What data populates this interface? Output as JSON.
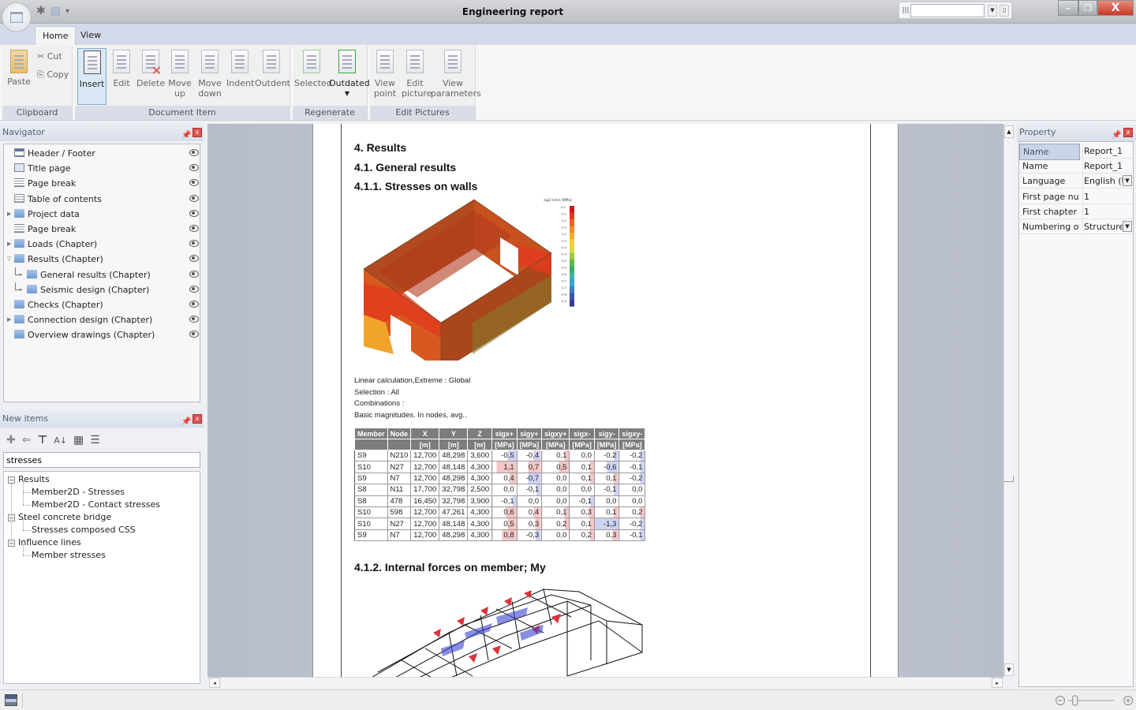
{
  "window": {
    "title": "Engineering report",
    "controls": {
      "minimize": "–",
      "maximize": "❐",
      "close": "X"
    }
  },
  "quick_access": {
    "gear": "✱",
    "doc": "▤",
    "more": "▾"
  },
  "ribbon": {
    "tabs": [
      {
        "label": "Home",
        "active": true
      },
      {
        "label": "View",
        "active": false
      }
    ],
    "groups": {
      "clipboard": {
        "label": "Clipboard",
        "paste": "Paste",
        "cut": "Cut",
        "copy": "Copy"
      },
      "document_item": {
        "label": "Document Item",
        "buttons": [
          "Insert",
          "Edit",
          "Delete",
          "Move up",
          "Move down",
          "Indent",
          "Outdent"
        ]
      },
      "regenerate": {
        "label": "Regenerate",
        "buttons": [
          "Selected",
          "Outdated"
        ]
      },
      "edit_pictures": {
        "label": "Edit Pictures",
        "buttons": [
          "View point",
          "Edit picture",
          "View parameters"
        ]
      }
    }
  },
  "navigator": {
    "title": "Navigator",
    "items": [
      {
        "label": "Header / Footer",
        "icon": "header-footer-icon",
        "level": 0,
        "expander": ""
      },
      {
        "label": "Title page",
        "icon": "title-page-icon",
        "level": 0,
        "expander": ""
      },
      {
        "label": "Page break",
        "icon": "page-break-icon",
        "level": 0,
        "expander": ""
      },
      {
        "label": "Table of contents",
        "icon": "toc-icon",
        "level": 0,
        "expander": ""
      },
      {
        "label": "Project data",
        "icon": "folder-icon",
        "level": 0,
        "expander": "▶"
      },
      {
        "label": "Page break",
        "icon": "page-break-icon",
        "level": 0,
        "expander": ""
      },
      {
        "label": "Loads (Chapter)",
        "icon": "folder-icon",
        "level": 0,
        "expander": "▶"
      },
      {
        "label": "Results (Chapter)",
        "icon": "folder-icon",
        "level": 0,
        "expander": "▽"
      },
      {
        "label": "General results (Chapter)",
        "icon": "folder-icon",
        "level": 1,
        "expander": "▸"
      },
      {
        "label": "Seismic design (Chapter)",
        "icon": "folder-icon",
        "level": 1,
        "expander": "▸"
      },
      {
        "label": "Checks (Chapter)",
        "icon": "folder-icon",
        "level": 0,
        "expander": ""
      },
      {
        "label": "Connection design (Chapter)",
        "icon": "folder-icon",
        "level": 0,
        "expander": "▶"
      },
      {
        "label": "Overview drawings (Chapter)",
        "icon": "folder-icon",
        "level": 0,
        "expander": ""
      }
    ]
  },
  "new_items": {
    "title": "New items",
    "toolbar": {
      "add": "✚",
      "back": "⇐",
      "filter": "⊤",
      "sort": "A↓",
      "group": "▦",
      "list": "☰"
    },
    "search_value": "stresses",
    "tree": [
      {
        "label": "Results",
        "children": [
          "Member2D - Stresses",
          "Member2D - Contact stresses"
        ]
      },
      {
        "label": "Steel concrete bridge",
        "children": [
          "Stresses composed CSS"
        ]
      },
      {
        "label": "Influence lines",
        "children": [
          "Member stresses"
        ]
      }
    ]
  },
  "document": {
    "headings": {
      "h1": "4. Results",
      "h2": "4.1. General results",
      "h3": "4.1.1. Stresses on walls",
      "h4": "4.1.2. Internal forces on member; My"
    },
    "figure_legend": {
      "title": "sig2+min [MPa]",
      "ticks": [
        "0.0",
        "-0.1",
        "-0.1",
        "-0.2",
        "-0.2",
        "-0.3",
        "-0.4",
        "-0.4",
        "-0.5",
        "-0.5",
        "-0.6",
        "-0.7",
        "-0.7",
        "-0.8",
        "-0.9"
      ],
      "colors": [
        "#d0161c",
        "#e13b1e",
        "#ec6322",
        "#f08a25",
        "#f6ad2b",
        "#f8cd33",
        "#d9d83a",
        "#9ccb3d",
        "#5cb947",
        "#3aae6a",
        "#3ab2a9",
        "#39a3d1",
        "#3b7ec4",
        "#3a57ad",
        "#3b3898"
      ]
    },
    "meta_lines": [
      "Linear calculation,Extreme  : Global",
      "Selection : All",
      "Combinations :",
      "Basic magnitudes.  In nodes, avg.."
    ],
    "table": {
      "headers": [
        [
          "Member",
          ""
        ],
        [
          "Node",
          ""
        ],
        [
          "X",
          "[m]"
        ],
        [
          "Y",
          "[m]"
        ],
        [
          "Z",
          "[m]"
        ],
        [
          "sigx+",
          "[MPa]"
        ],
        [
          "sigy+",
          "[MPa]"
        ],
        [
          "sigxy+",
          "[MPa]"
        ],
        [
          "sigx-",
          "[MPa]"
        ],
        [
          "sigy-",
          "[MPa]"
        ],
        [
          "sigxy-",
          "[MPa]"
        ]
      ],
      "rows": [
        [
          "S9",
          "N210",
          "12,700",
          "48,298",
          "3,600",
          "-0,5",
          "-0,4",
          "0,1",
          "0,0",
          "-0,2",
          "-0,2"
        ],
        [
          "S10",
          "N27",
          "12,700",
          "48,148",
          "4,300",
          "1,1",
          "0,7",
          "0,5",
          "0,1",
          "-0,6",
          "-0,1"
        ],
        [
          "S9",
          "N7",
          "12,700",
          "48,298",
          "4,300",
          "0,4",
          "-0,7",
          "0,0",
          "0,1",
          "0,1",
          "-0,2"
        ],
        [
          "S8",
          "N11",
          "17,700",
          "32,798",
          "2,500",
          "0,0",
          "-0,1",
          "0,0",
          "0,0",
          "-0,1",
          "0,0"
        ],
        [
          "S8",
          "478",
          "16,450",
          "32,798",
          "3,900",
          "-0,1",
          "0,0",
          "0,0",
          "-0,1",
          "0,0",
          "0,0"
        ],
        [
          "S10",
          "598",
          "12,700",
          "47,261",
          "4,300",
          "0,6",
          "0,4",
          "0,1",
          "0,3",
          "0,1",
          "0,2"
        ],
        [
          "S10",
          "N27",
          "12,700",
          "48,148",
          "4,300",
          "0,5",
          "0,3",
          "0,2",
          "0,1",
          "-1,3",
          "-0,2"
        ],
        [
          "S9",
          "N7",
          "12,700",
          "48,298",
          "4,300",
          "0,8",
          "-0,3",
          "0,0",
          "0,2",
          "0,3",
          "-0,1"
        ]
      ],
      "positive_tint": "#f4c6c6",
      "negative_tint": "#cfd3f2"
    }
  },
  "property": {
    "title": "Property",
    "rows": [
      {
        "key": "Name",
        "value": "Report_1",
        "selected": true,
        "dropdown": false
      },
      {
        "key": "Name",
        "value": "Report_1",
        "selected": false,
        "dropdown": false
      },
      {
        "key": "Language",
        "value": "English (Un",
        "selected": false,
        "dropdown": true
      },
      {
        "key": "First page nu...",
        "value": "1",
        "selected": false,
        "dropdown": false
      },
      {
        "key": "First chapter n...",
        "value": "1",
        "selected": false,
        "dropdown": false
      },
      {
        "key": "Numbering of ...",
        "value": "Structured",
        "selected": false,
        "dropdown": true
      }
    ]
  },
  "statusbar": {
    "zoom_minus": "−",
    "zoom_plus": "+",
    "zoom_level_fraction": 0.15
  }
}
